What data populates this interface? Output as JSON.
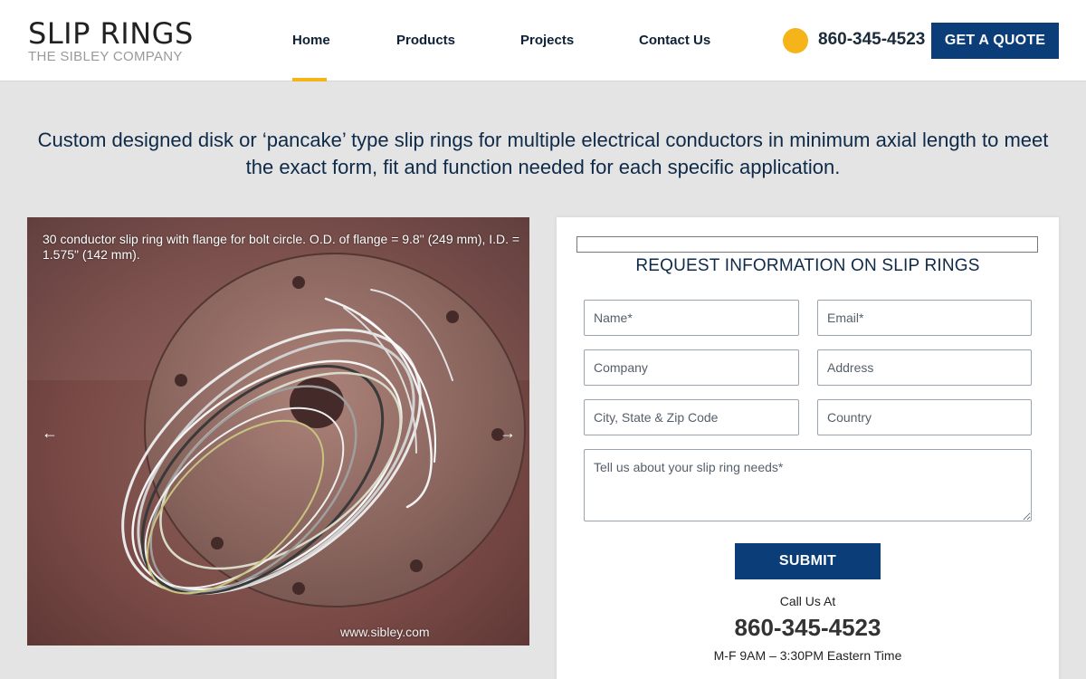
{
  "logo": {
    "title": "SLIP RINGS",
    "subtitle": "THE SIBLEY COMPANY"
  },
  "nav": {
    "items": [
      "Home",
      "Products",
      "Projects",
      "Contact Us"
    ],
    "active": "Home"
  },
  "header": {
    "phone": "860-345-4523",
    "quote_button": "GET A QUOTE"
  },
  "intro": {
    "text": "Custom designed disk or ‘pancake’ type slip rings for multiple electrical conductors in minimum axial length to meet the exact form, fit and function needed for each specific application."
  },
  "slider": {
    "caption": "30 conductor slip ring with flange for bolt circle.  O.D. of flange = 9.8\" (249 mm), I.D. = 1.575\" (142 mm).",
    "watermark": "www.sibley.com",
    "prev_icon": "←",
    "next_icon": "→"
  },
  "form": {
    "title": "REQUEST INFORMATION ON SLIP RINGS",
    "name_placeholder": "Name*",
    "email_placeholder": "Email*",
    "company_placeholder": "Company",
    "address_placeholder": "Address",
    "city_placeholder": "City, State & Zip Code",
    "country_placeholder": "Country",
    "message_placeholder": "Tell us about your slip ring needs*",
    "submit_label": "SUBMIT"
  },
  "contact": {
    "call_label": "Call Us At",
    "phone": "860-345-4523",
    "hours": "M-F 9AM – 3:30PM Eastern Time"
  },
  "colors": {
    "accent": "#f5b41a",
    "primary": "#0b3d78",
    "background": "#e4e4e4"
  }
}
